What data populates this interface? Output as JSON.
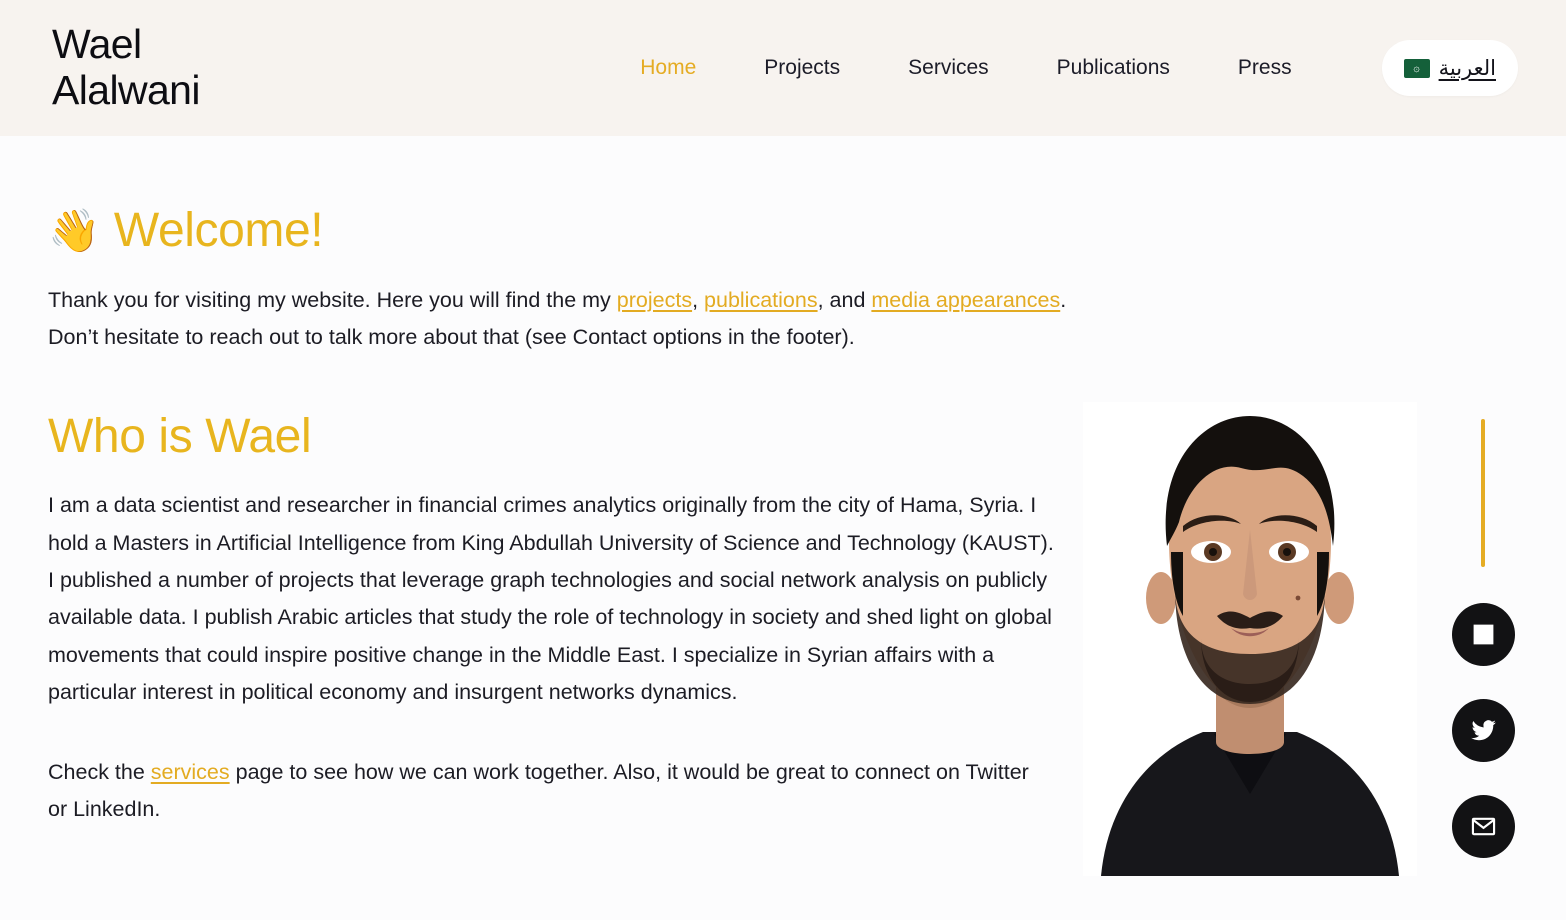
{
  "header": {
    "brand": "Wael\nAlalwani",
    "nav": [
      {
        "label": "Home",
        "active": true
      },
      {
        "label": "Projects",
        "active": false
      },
      {
        "label": "Services",
        "active": false
      },
      {
        "label": "Publications",
        "active": false
      },
      {
        "label": "Press",
        "active": false
      }
    ],
    "language_switch": {
      "label": "العربية",
      "flag_icon": "saudi-arabia-flag-icon",
      "flag_glyph": "۞"
    },
    "background_color": "#f7f3ef"
  },
  "main": {
    "welcome": {
      "emoji": "👋",
      "emoji_name": "waving-hand-emoji",
      "title": "Welcome!"
    },
    "intro": {
      "part1": "Thank you for visiting my website. Here you will find the my ",
      "link_projects": "projects",
      "sep1": ", ",
      "link_publications": "publications",
      "sep2": ", and ",
      "link_media": "media appearances",
      "part2": ". Don’t hesitate to reach out to talk more about that (see Contact options in the footer)."
    },
    "who": {
      "title": "Who is Wael",
      "body": "I am a data scientist and researcher in financial crimes analytics originally from the city of Hama, Syria. I hold a Masters in Artificial Intelligence from King Abdullah University of Science and Technology (KAUST). I published a number of projects that leverage graph technologies and social network analysis on publicly available data. I publish Arabic articles that study the role of technology in society and shed light on global movements that could inspire positive change in the Middle East. I specialize in Syrian affairs with a particular interest in political economy and insurgent networks dynamics."
    },
    "closing": {
      "part1": "Check the ",
      "link_services": "services",
      "part2": " page to see how we can work together. Also, it would be great to connect on Twitter or LinkedIn."
    },
    "portrait": {
      "alt": "Portrait photo of Wael Alalwani"
    }
  },
  "social": {
    "items": [
      {
        "name": "linkedin-icon",
        "label": "LinkedIn"
      },
      {
        "name": "twitter-icon",
        "label": "Twitter"
      },
      {
        "name": "email-icon",
        "label": "Email"
      }
    ],
    "accent_color": "#e5ac24",
    "button_color": "#121214"
  },
  "theme": {
    "accent": "#e8b51e",
    "link": "#e3ab22",
    "text": "#1c1c24",
    "page_background": "#fcfcfd"
  }
}
